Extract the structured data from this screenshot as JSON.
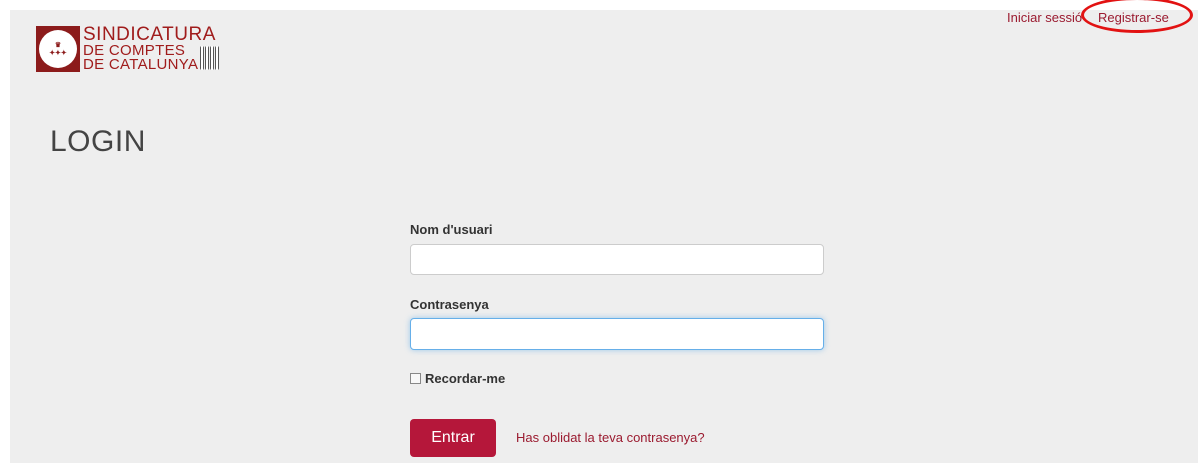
{
  "brand": {
    "line1": "SINDICATURA",
    "line2": "DE COMPTES",
    "line3": "DE CATALUNYA",
    "color": "#a01c1c"
  },
  "nav": {
    "login_label": "Iniciar sessió",
    "register_label": "Registrar-se",
    "link_color": "#9b1b30",
    "highlight_color": "#e21212"
  },
  "page": {
    "title": "LOGIN"
  },
  "form": {
    "username_label": "Nom d'usuari",
    "username_value": "",
    "password_label": "Contrasenya",
    "password_value": "",
    "remember_label": "Recordar-me",
    "remember_checked": false,
    "submit_label": "Entrar",
    "forgot_label": "Has oblidat la teva contrasenya?",
    "button_color": "#b5173a"
  },
  "icons": {
    "logo": "shield-emblem-icon",
    "logo_mark": "four-bars-icon"
  }
}
